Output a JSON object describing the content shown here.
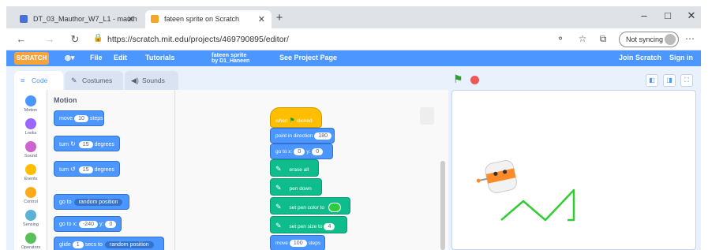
{
  "browser": {
    "tabs": [
      {
        "label": "DT_03_Mauthor_W7_L1 - mauth"
      },
      {
        "label": "fateen sprite on Scratch"
      }
    ],
    "new_tab": "+",
    "url": "https://scratch.mit.edu/projects/469790895/editor/",
    "sync_label": "Not syncing",
    "controls": {
      "minimize": "–",
      "maximize": "□",
      "close": "✕"
    }
  },
  "scratch_menu": {
    "logo": "SCRATCH",
    "items": [
      "File",
      "Edit",
      "Tutorials",
      "fateen sprite",
      "by D1_Haneen",
      "See Project Page"
    ],
    "right": [
      "Join Scratch",
      "Sign in"
    ]
  },
  "editor_tabs": [
    "Code",
    "Costumes",
    "Sounds"
  ],
  "categories": [
    {
      "label": "Motion",
      "color": "#4c97ff"
    },
    {
      "label": "Looks",
      "color": "#9966ff"
    },
    {
      "label": "Sound",
      "color": "#cf63cf"
    },
    {
      "label": "Events",
      "color": "#ffbf00"
    },
    {
      "label": "Control",
      "color": "#ffab19"
    },
    {
      "label": "Sensing",
      "color": "#5cb1d6"
    },
    {
      "label": "Operators",
      "color": "#59c059"
    }
  ],
  "palette": {
    "title": "Motion",
    "blocks": [
      {
        "pre": "move",
        "val": "10",
        "post": "steps"
      },
      {
        "pre": "turn",
        "glyph": "↻",
        "val": "15",
        "post": "degrees"
      },
      {
        "pre": "turn",
        "glyph": "↺",
        "val": "15",
        "post": "degrees"
      },
      {
        "pre": "go to",
        "dd": "random position"
      },
      {
        "pre": "go to x:",
        "val": "-240",
        "mid": "y:",
        "val2": "0"
      },
      {
        "pre": "glide",
        "val": "1",
        "mid": "secs to",
        "dd": "random position"
      }
    ]
  },
  "script": {
    "hat": {
      "pre": "when",
      "post": "clicked"
    },
    "blocks": [
      {
        "type": "motion",
        "pre": "point in direction",
        "val": "180"
      },
      {
        "type": "motion",
        "pre": "go to x:",
        "val": "0",
        "mid": "y:",
        "val2": "0"
      },
      {
        "type": "pen",
        "pre": "erase all"
      },
      {
        "type": "pen",
        "pre": "pen down"
      },
      {
        "type": "pen",
        "pre": "set pen color to"
      },
      {
        "type": "pen",
        "pre": "set pen size to",
        "val": "4"
      },
      {
        "type": "motion",
        "pre": "move",
        "val": "100",
        "post": "steps"
      }
    ],
    "pen_color": "#2ecc40"
  },
  "stage": {
    "line_color": "#33cc33"
  }
}
